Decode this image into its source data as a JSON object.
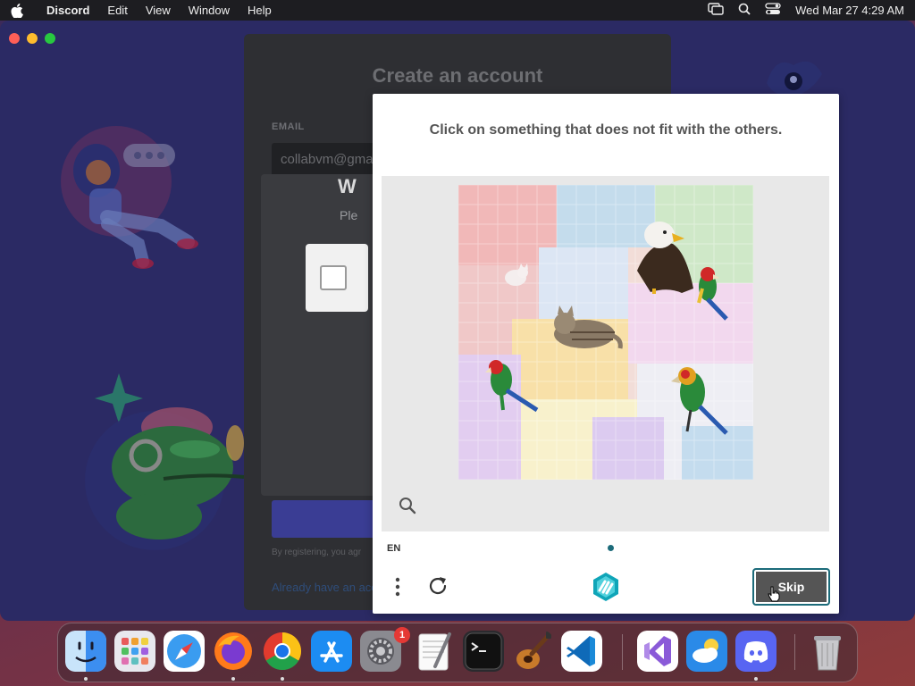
{
  "menubar": {
    "app_name": "Discord",
    "items": [
      "Edit",
      "View",
      "Window",
      "Help"
    ],
    "clock": "Wed Mar 27  4:29 AM"
  },
  "register": {
    "title": "Create an account",
    "email_label": "EMAIL",
    "email_value": "collabvm@gma",
    "modal_title": "W",
    "modal_subtitle": "Ple",
    "terms_text": "By registering, you agr",
    "login_link": "Already have an acc"
  },
  "captcha": {
    "prompt": "Click on something that does not fit with the others.",
    "language": "EN",
    "skip_label": "Skip",
    "colors": {
      "accent": "#1c6b7a",
      "skip_bg": "#555555"
    }
  },
  "dock": {
    "items": [
      {
        "name": "Finder",
        "icon": "finder-icon",
        "running": true
      },
      {
        "name": "Launchpad",
        "icon": "launchpad-icon",
        "running": false
      },
      {
        "name": "Safari",
        "icon": "safari-icon",
        "running": false
      },
      {
        "name": "Firefox",
        "icon": "firefox-icon",
        "running": true
      },
      {
        "name": "Chrome",
        "icon": "chrome-icon",
        "running": true
      },
      {
        "name": "App Store",
        "icon": "app-store-icon",
        "running": false
      },
      {
        "name": "System Settings",
        "icon": "system-settings-icon",
        "running": false,
        "badge": "1"
      },
      {
        "name": "TextEdit",
        "icon": "textedit-icon",
        "running": false
      },
      {
        "name": "Terminal",
        "icon": "terminal-icon",
        "running": false
      },
      {
        "name": "GarageBand",
        "icon": "garageband-icon",
        "running": false
      },
      {
        "name": "Visual Studio Code",
        "icon": "vscode-icon",
        "running": false
      },
      {
        "name": "Visual Studio",
        "icon": "visual-studio-icon",
        "running": false
      },
      {
        "name": "Weather",
        "icon": "weather-icon",
        "running": false
      },
      {
        "name": "Discord",
        "icon": "discord-icon",
        "running": true
      },
      {
        "name": "Trash",
        "icon": "trash-icon",
        "running": false
      }
    ]
  }
}
